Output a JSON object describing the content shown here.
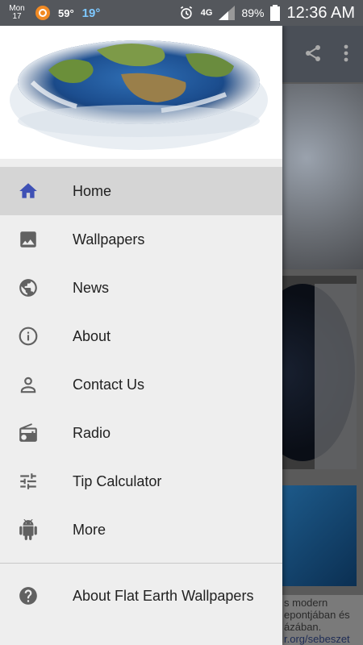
{
  "status_bar": {
    "day": "Mon",
    "date": "17",
    "temp_primary": "59°",
    "temp_secondary": "19°",
    "network": "4G",
    "battery": "89%",
    "time": "12:36 AM"
  },
  "drawer": {
    "items": [
      {
        "label": "Home",
        "icon": "home-icon",
        "active": true
      },
      {
        "label": "Wallpapers",
        "icon": "image-icon"
      },
      {
        "label": "News",
        "icon": "globe-icon"
      },
      {
        "label": "About",
        "icon": "info-icon"
      },
      {
        "label": "Contact Us",
        "icon": "person-icon"
      },
      {
        "label": "Radio",
        "icon": "radio-icon"
      },
      {
        "label": "Tip Calculator",
        "icon": "sliders-icon"
      },
      {
        "label": "More",
        "icon": "android-icon"
      }
    ],
    "footer_item": {
      "label": "About Flat Earth Wallpapers",
      "icon": "help-icon"
    }
  },
  "ad": {
    "line1": "s modern",
    "line2": "epontjában és",
    "line3": "ázában.",
    "line4": "r.org/sebeszet"
  },
  "colors": {
    "accent": "#3f51b5",
    "drawer_bg": "#eeeeee",
    "active_bg": "#d5d5d5",
    "icon": "#616161"
  }
}
